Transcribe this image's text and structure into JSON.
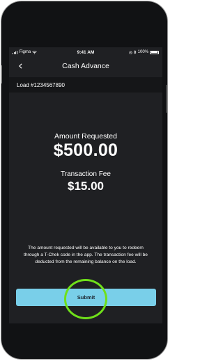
{
  "status_bar": {
    "carrier": "Figma",
    "time": "9:41 AM",
    "battery": "100%"
  },
  "nav": {
    "title": "Cash Advance"
  },
  "load": {
    "label": "Load #1234567890"
  },
  "amount": {
    "label": "Amount Requested",
    "value": "$500.00"
  },
  "fee": {
    "label": "Transaction Fee",
    "value": "$15.00"
  },
  "info_text": "The amount requested will be available to you to redeem through a T-Chek code in the app. The transaction fee will be deducted from the remaining balance on the load.",
  "submit_label": "Submit",
  "colors": {
    "screen_bg": "#1f2023",
    "button": "#79cfe9",
    "highlight": "#6fe01a"
  },
  "icons": [
    "signal-icon",
    "wifi-icon",
    "alarm-icon",
    "bluetooth-icon",
    "battery-icon",
    "back-chevron-icon"
  ]
}
